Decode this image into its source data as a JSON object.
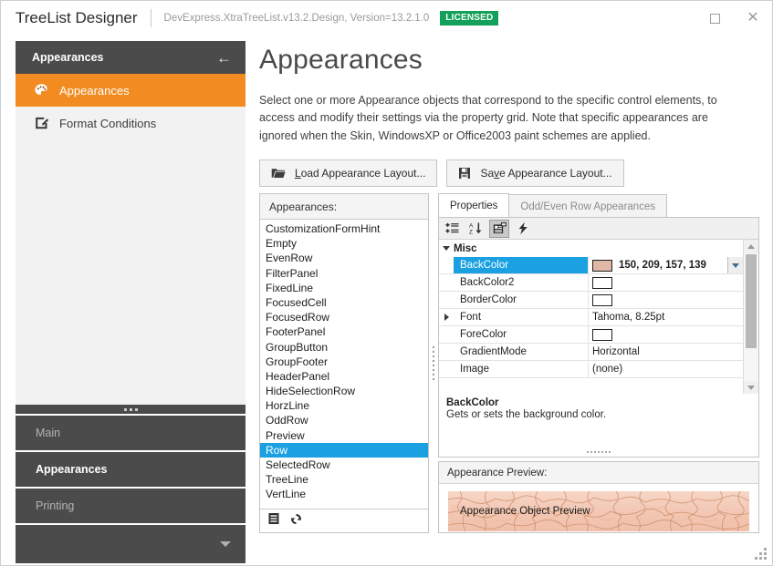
{
  "titlebar": {
    "app_title": "TreeList Designer",
    "assembly": "DevExpress.XtraTreeList.v13.2.Design, Version=13.2.1.0",
    "license_badge": "LICENSED",
    "maximize_icon": "maximize-icon",
    "close_icon": "close-icon"
  },
  "sidebar": {
    "header_title": "Appearances",
    "back_icon": "arrow-left-icon",
    "items": [
      {
        "label": "Appearances",
        "icon": "palette-icon",
        "active": true
      },
      {
        "label": "Format Conditions",
        "icon": "edit-square-icon",
        "active": false
      }
    ],
    "groups": [
      {
        "label": "Main",
        "current": false
      },
      {
        "label": "Appearances",
        "current": true
      },
      {
        "label": "Printing",
        "current": false
      }
    ],
    "more_icon": "chevron-down-icon"
  },
  "main": {
    "page_title": "Appearances",
    "description": "Select one or more Appearance objects that correspond to the specific control elements, to access and modify their settings via the property grid. Note that specific appearances are ignored when the Skin, WindowsXP or Office2003 paint schemes are applied.",
    "buttons": [
      {
        "label": "Load Appearance Layout...",
        "mnemonic": "L",
        "icon": "open-folder-icon"
      },
      {
        "label": "Save Appearance Layout...",
        "mnemonic": "v",
        "icon": "floppy-save-icon"
      }
    ]
  },
  "appearances_list": {
    "header": "Appearances:",
    "selected": "Row",
    "items": [
      "CustomizationFormHint",
      "Empty",
      "EvenRow",
      "FilterPanel",
      "FixedLine",
      "FocusedCell",
      "FocusedRow",
      "FooterPanel",
      "GroupButton",
      "GroupFooter",
      "HeaderPanel",
      "HideSelectionRow",
      "HorzLine",
      "OddRow",
      "Preview",
      "Row",
      "SelectedRow",
      "TreeLine",
      "VertLine"
    ],
    "footer_icons": [
      {
        "name": "properties-list-icon"
      },
      {
        "name": "reset-refresh-icon"
      }
    ]
  },
  "property_panel": {
    "tabs": [
      {
        "label": "Properties",
        "active": true
      },
      {
        "label": "Odd/Even Row Appearances",
        "active": false
      }
    ],
    "toolbar_icons": [
      {
        "name": "categorized-icon",
        "pressed": false
      },
      {
        "name": "alphabetical-sort-icon",
        "pressed": false
      },
      {
        "name": "property-pages-icon",
        "pressed": true
      },
      {
        "name": "events-lightning-icon",
        "pressed": false
      }
    ],
    "category": "Misc",
    "category_expanded": true,
    "rows": [
      {
        "name": "BackColor",
        "value": "150, 209, 157, 139",
        "kind": "color",
        "swatch": "#e0b8a8",
        "selected": true,
        "expandable": false,
        "dropdown": true
      },
      {
        "name": "BackColor2",
        "value": "",
        "kind": "color",
        "swatch": "#ffffff",
        "selected": false,
        "expandable": false,
        "dropdown": false
      },
      {
        "name": "BorderColor",
        "value": "",
        "kind": "color",
        "swatch": "#ffffff",
        "selected": false,
        "expandable": false,
        "dropdown": false
      },
      {
        "name": "Font",
        "value": "Tahoma, 8.25pt",
        "kind": "text",
        "swatch": "",
        "selected": false,
        "expandable": true,
        "dropdown": false
      },
      {
        "name": "ForeColor",
        "value": "",
        "kind": "color",
        "swatch": "#ffffff",
        "selected": false,
        "expandable": false,
        "dropdown": false
      },
      {
        "name": "GradientMode",
        "value": "Horizontal",
        "kind": "text",
        "swatch": "",
        "selected": false,
        "expandable": false,
        "dropdown": false
      },
      {
        "name": "Image",
        "value": "(none)",
        "kind": "text",
        "swatch": "",
        "selected": false,
        "expandable": false,
        "dropdown": false
      }
    ],
    "scrollbar": {
      "up_icon": "scroll-up-icon",
      "down_icon": "scroll-down-icon",
      "thumb_percent": 75
    },
    "description": {
      "title": "BackColor",
      "text": "Gets or sets the background color."
    }
  },
  "preview": {
    "header": "Appearance Preview:",
    "label": "Appearance Object Preview",
    "base_color": "#f4cdbc",
    "crack_color": "#c98a63"
  },
  "colors": {
    "accent_orange": "#f28c20",
    "selection_blue": "#1ba1e2",
    "license_green": "#13a05a",
    "sidebar_dark": "#4b4b4b",
    "panel_bg": "#f2f2f2"
  },
  "resize_grip_icon": "resize-grip-icon"
}
